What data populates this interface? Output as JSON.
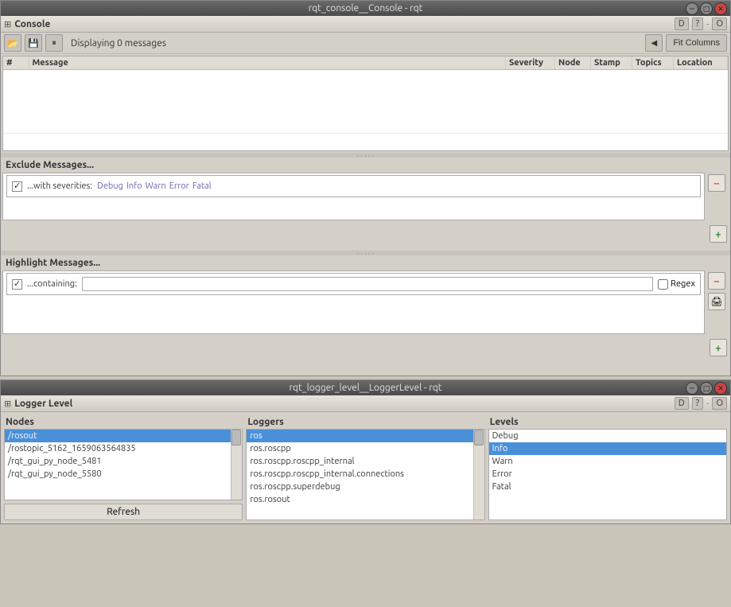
{
  "console_window": {
    "title": "rqt_console__Console - rqt",
    "panel_name": "Console",
    "status": "Displaying 0 messages",
    "fit_cols_btn": "Fit Columns",
    "table": {
      "columns": [
        "#",
        "Message",
        "Severity",
        "Node",
        "Stamp",
        "Topics",
        "Location"
      ]
    },
    "exclude_section": {
      "label": "Exclude Messages...",
      "filter_row": {
        "checkbox_checked": true,
        "label": "...with severities:",
        "tags": [
          "Debug",
          "Info",
          "Warn",
          "Error",
          "Fatal"
        ]
      }
    },
    "highlight_section": {
      "label": "Highlight Messages...",
      "filter_row": {
        "checkbox_checked": true,
        "label": "...containing:",
        "placeholder": "",
        "regex_label": "Regex"
      }
    }
  },
  "logger_window": {
    "title": "rqt_logger_level__LoggerLevel - rqt",
    "panel_name": "Logger Level",
    "nodes_label": "Nodes",
    "loggers_label": "Loggers",
    "levels_label": "Levels",
    "nodes": [
      {
        "name": "/rosout",
        "selected": true
      },
      {
        "name": "/rostopic_5162_1659063564835",
        "selected": false
      },
      {
        "name": "/rqt_gui_py_node_5481",
        "selected": false
      },
      {
        "name": "/rqt_gui_py_node_5580",
        "selected": false
      }
    ],
    "loggers": [
      {
        "name": "ros",
        "selected": true
      },
      {
        "name": "ros.roscpp",
        "selected": false
      },
      {
        "name": "ros.roscpp.roscpp_internal",
        "selected": false
      },
      {
        "name": "ros.roscpp.roscpp_internal.connections",
        "selected": false
      },
      {
        "name": "ros.roscpp.superdebug",
        "selected": false
      },
      {
        "name": "ros.rosout",
        "selected": false
      }
    ],
    "levels": [
      {
        "name": "Debug",
        "selected": false
      },
      {
        "name": "Info",
        "selected": true
      },
      {
        "name": "Warn",
        "selected": false
      },
      {
        "name": "Error",
        "selected": false
      },
      {
        "name": "Fatal",
        "selected": false
      }
    ],
    "refresh_btn": "Refresh"
  },
  "icons": {
    "minimize": "─",
    "maximize": "□",
    "close": "✕",
    "help": "?",
    "d_btn": "D",
    "open_file": "📂",
    "save_file": "💾",
    "pause": "⏸",
    "print": "🖨",
    "minus": "−",
    "plus": "+"
  }
}
